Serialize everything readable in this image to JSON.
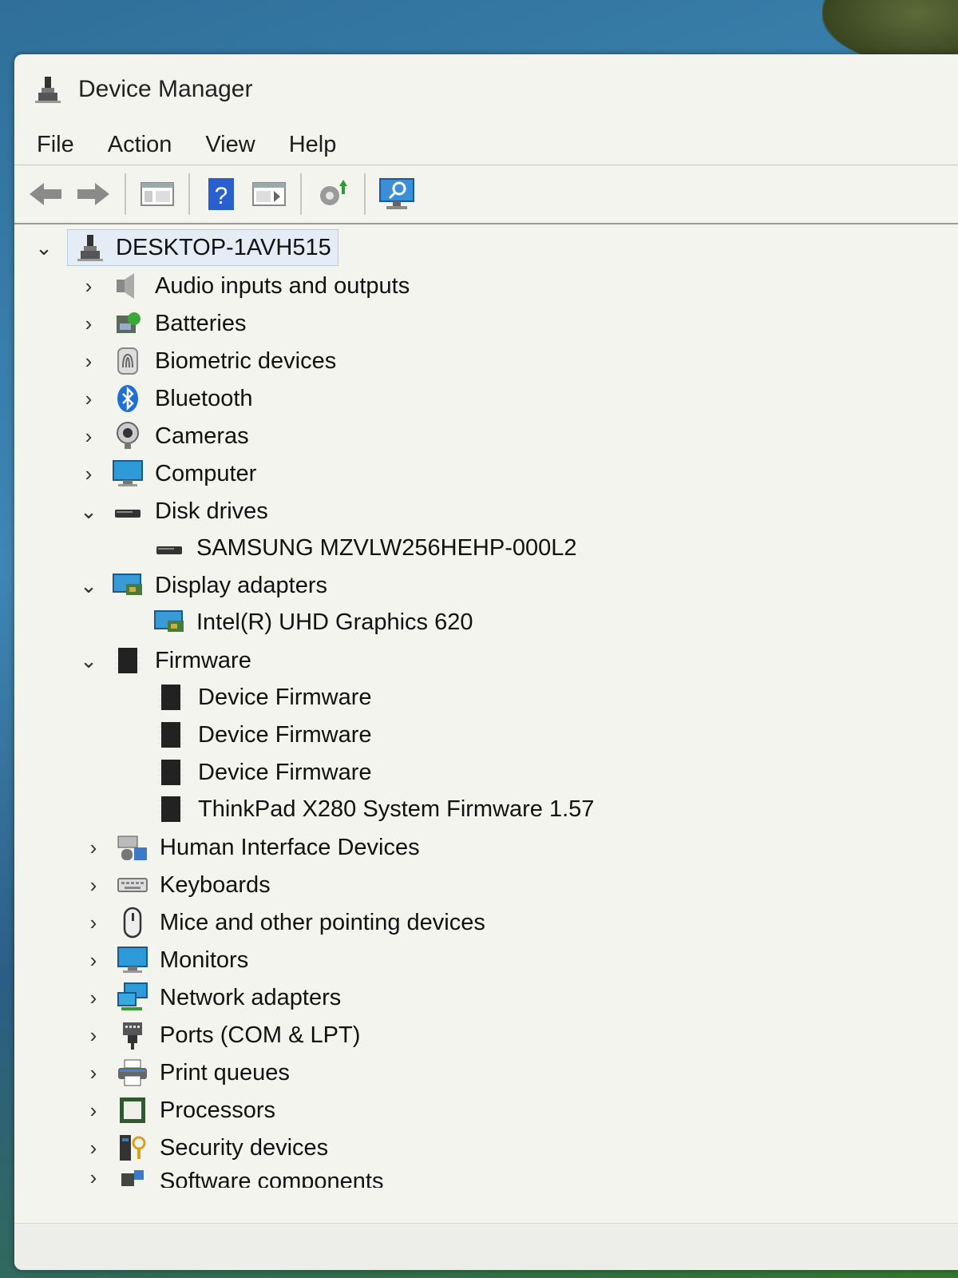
{
  "window": {
    "title": "Device Manager"
  },
  "menu": [
    "File",
    "Action",
    "View",
    "Help"
  ],
  "toolbar": [
    {
      "name": "back-button",
      "icon": "arrow-left-icon"
    },
    {
      "name": "forward-button",
      "icon": "arrow-right-icon"
    },
    {
      "name": "show-hide-console-tree-button",
      "icon": "console-tree-icon"
    },
    {
      "name": "help-button",
      "icon": "help-icon"
    },
    {
      "name": "show-action-pane-button",
      "icon": "action-pane-icon"
    },
    {
      "name": "update-driver-button",
      "icon": "update-driver-icon"
    },
    {
      "name": "scan-hardware-button",
      "icon": "monitor-scan-icon"
    }
  ],
  "tree": {
    "root": "DESKTOP-1AVH515",
    "items": [
      {
        "label": "Audio inputs and outputs",
        "icon": "speaker-icon",
        "expanded": false
      },
      {
        "label": "Batteries",
        "icon": "battery-icon",
        "expanded": false
      },
      {
        "label": "Biometric devices",
        "icon": "fingerprint-icon",
        "expanded": false
      },
      {
        "label": "Bluetooth",
        "icon": "bluetooth-icon",
        "expanded": false
      },
      {
        "label": "Cameras",
        "icon": "camera-icon",
        "expanded": false
      },
      {
        "label": "Computer",
        "icon": "computer-icon",
        "expanded": false
      },
      {
        "label": "Disk drives",
        "icon": "disk-drive-icon",
        "expanded": true,
        "children": [
          {
            "label": "SAMSUNG MZVLW256HEHP-000L2",
            "icon": "disk-drive-icon"
          }
        ]
      },
      {
        "label": "Display adapters",
        "icon": "display-adapter-icon",
        "expanded": true,
        "children": [
          {
            "label": "Intel(R) UHD Graphics 620",
            "icon": "display-adapter-icon"
          }
        ]
      },
      {
        "label": "Firmware",
        "icon": "chip-icon",
        "expanded": true,
        "children": [
          {
            "label": "Device Firmware",
            "icon": "chip-icon"
          },
          {
            "label": "Device Firmware",
            "icon": "chip-icon"
          },
          {
            "label": "Device Firmware",
            "icon": "chip-icon"
          },
          {
            "label": "ThinkPad X280 System Firmware 1.57",
            "icon": "chip-icon"
          }
        ]
      },
      {
        "label": "Human Interface Devices",
        "icon": "hid-icon",
        "expanded": false
      },
      {
        "label": "Keyboards",
        "icon": "keyboard-icon",
        "expanded": false
      },
      {
        "label": "Mice and other pointing devices",
        "icon": "mouse-icon",
        "expanded": false
      },
      {
        "label": "Monitors",
        "icon": "monitor-icon",
        "expanded": false
      },
      {
        "label": "Network adapters",
        "icon": "network-icon",
        "expanded": false
      },
      {
        "label": "Ports (COM & LPT)",
        "icon": "port-icon",
        "expanded": false
      },
      {
        "label": "Print queues",
        "icon": "printer-icon",
        "expanded": false
      },
      {
        "label": "Processors",
        "icon": "processor-icon",
        "expanded": false
      },
      {
        "label": "Security devices",
        "icon": "security-icon",
        "expanded": false
      },
      {
        "label": "Software components",
        "icon": "software-icon",
        "expanded": false
      }
    ]
  }
}
